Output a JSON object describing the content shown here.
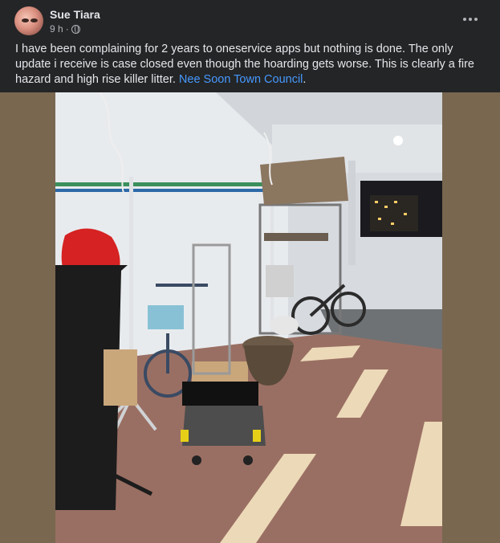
{
  "post": {
    "author": "Sue Tiara",
    "time": "9 h",
    "separator": "·",
    "privacy_icon": "globe-icon",
    "more_icon": "more-options-icon",
    "text_body": "I have been complaining for 2 years to oneservice apps but nothing is done. The only update i receive is case closed even though the hoarding gets worse. This is clearly a fire hazard and high rise killer litter. ",
    "mention": "Nee Soon Town Council",
    "text_end": "."
  },
  "photo": {
    "description_icon": "corridor-photo",
    "colors": {
      "frame": "#796750",
      "floor": "#9a6f63",
      "tile_stripe": "#ecd9b8",
      "wall": "#e9ecef"
    }
  }
}
